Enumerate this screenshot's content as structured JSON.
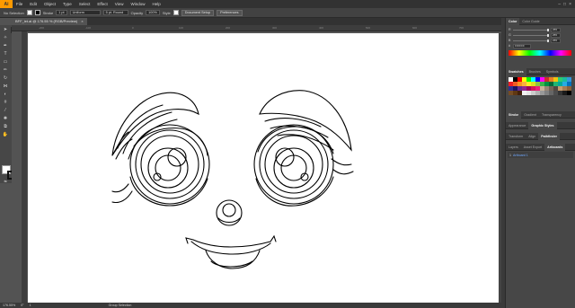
{
  "app": {
    "logo": "Ai"
  },
  "menu": [
    "File",
    "Edit",
    "Object",
    "Type",
    "Select",
    "Effect",
    "View",
    "Window",
    "Help"
  ],
  "control_bar": {
    "selection": "No Selection",
    "stroke_label": "Stroke",
    "stroke_value": "1 pt",
    "profile": "Uniform",
    "brush": "5 pt. Round",
    "opacity_label": "Opacity",
    "opacity_value": "100%",
    "style_label": "Style",
    "doc_setup": "Document Setup",
    "preferences": "Preferences"
  },
  "document_tab": {
    "title": "BFF_let.ai @ 176.55 % (RGB/Preview)",
    "close": "×"
  },
  "ruler": {
    "h_ticks": [
      "-200",
      "-100",
      "0",
      "100",
      "200",
      "300",
      "400",
      "500",
      "600",
      "700",
      "800"
    ]
  },
  "status": {
    "zoom": "176.55%",
    "rotation": "0°",
    "artboard": "1",
    "tool": "Group Selection"
  },
  "panels": {
    "color": {
      "tabs": [
        "Color",
        "Color Guide"
      ],
      "sliders": [
        {
          "label": "R",
          "value": "255",
          "pos": 1.0
        },
        {
          "label": "G",
          "value": "255",
          "pos": 1.0
        },
        {
          "label": "B",
          "value": "255",
          "pos": 1.0
        }
      ],
      "hex": "FFFFFF"
    },
    "swatches": {
      "tabs": [
        "Swatches",
        "Brushes",
        "Symbols"
      ]
    },
    "stroke": {
      "tabs": [
        "Stroke",
        "Gradient",
        "Transparency"
      ]
    },
    "appearance": {
      "tabs": [
        "Appearance",
        "Graphic Styles"
      ]
    },
    "transform": {
      "tabs": [
        "Transform",
        "Align",
        "Pathfinder"
      ]
    },
    "layers": {
      "tabs": [
        "Layers",
        "Asset Export",
        "Artboards"
      ],
      "items": [
        {
          "num": "1",
          "name": "Artboard 1"
        }
      ]
    }
  },
  "swatch_colors": [
    "#ffffff",
    "#000000",
    "#ff0000",
    "#ffff00",
    "#00ff00",
    "#00ffff",
    "#0000ff",
    "#ff00ff",
    "#c9302c",
    "#e67e22",
    "#f1c40f",
    "#2ecc71",
    "#1abc9c",
    "#3498db",
    "#ee1d24",
    "#f15a24",
    "#f7931e",
    "#fbb03b",
    "#fcee21",
    "#d9e021",
    "#8cc63f",
    "#39b54a",
    "#009245",
    "#006837",
    "#22b573",
    "#00a99d",
    "#29abe2",
    "#0071bc",
    "#2e3192",
    "#1b1464",
    "#662d91",
    "#93278f",
    "#9e005d",
    "#d4145a",
    "#ed1e79",
    "#c7b299",
    "#998675",
    "#736357",
    "#534741",
    "#c69c6d",
    "#a67c52",
    "#8c6239",
    "#754c24",
    "#603813",
    "#42210b",
    "#f2f2f2",
    "#e6e6e6",
    "#cccccc",
    "#b3b3b3",
    "#999999",
    "#808080",
    "#666666",
    "#4d4d4d",
    "#333333",
    "#1a1a1a",
    "#000000"
  ]
}
